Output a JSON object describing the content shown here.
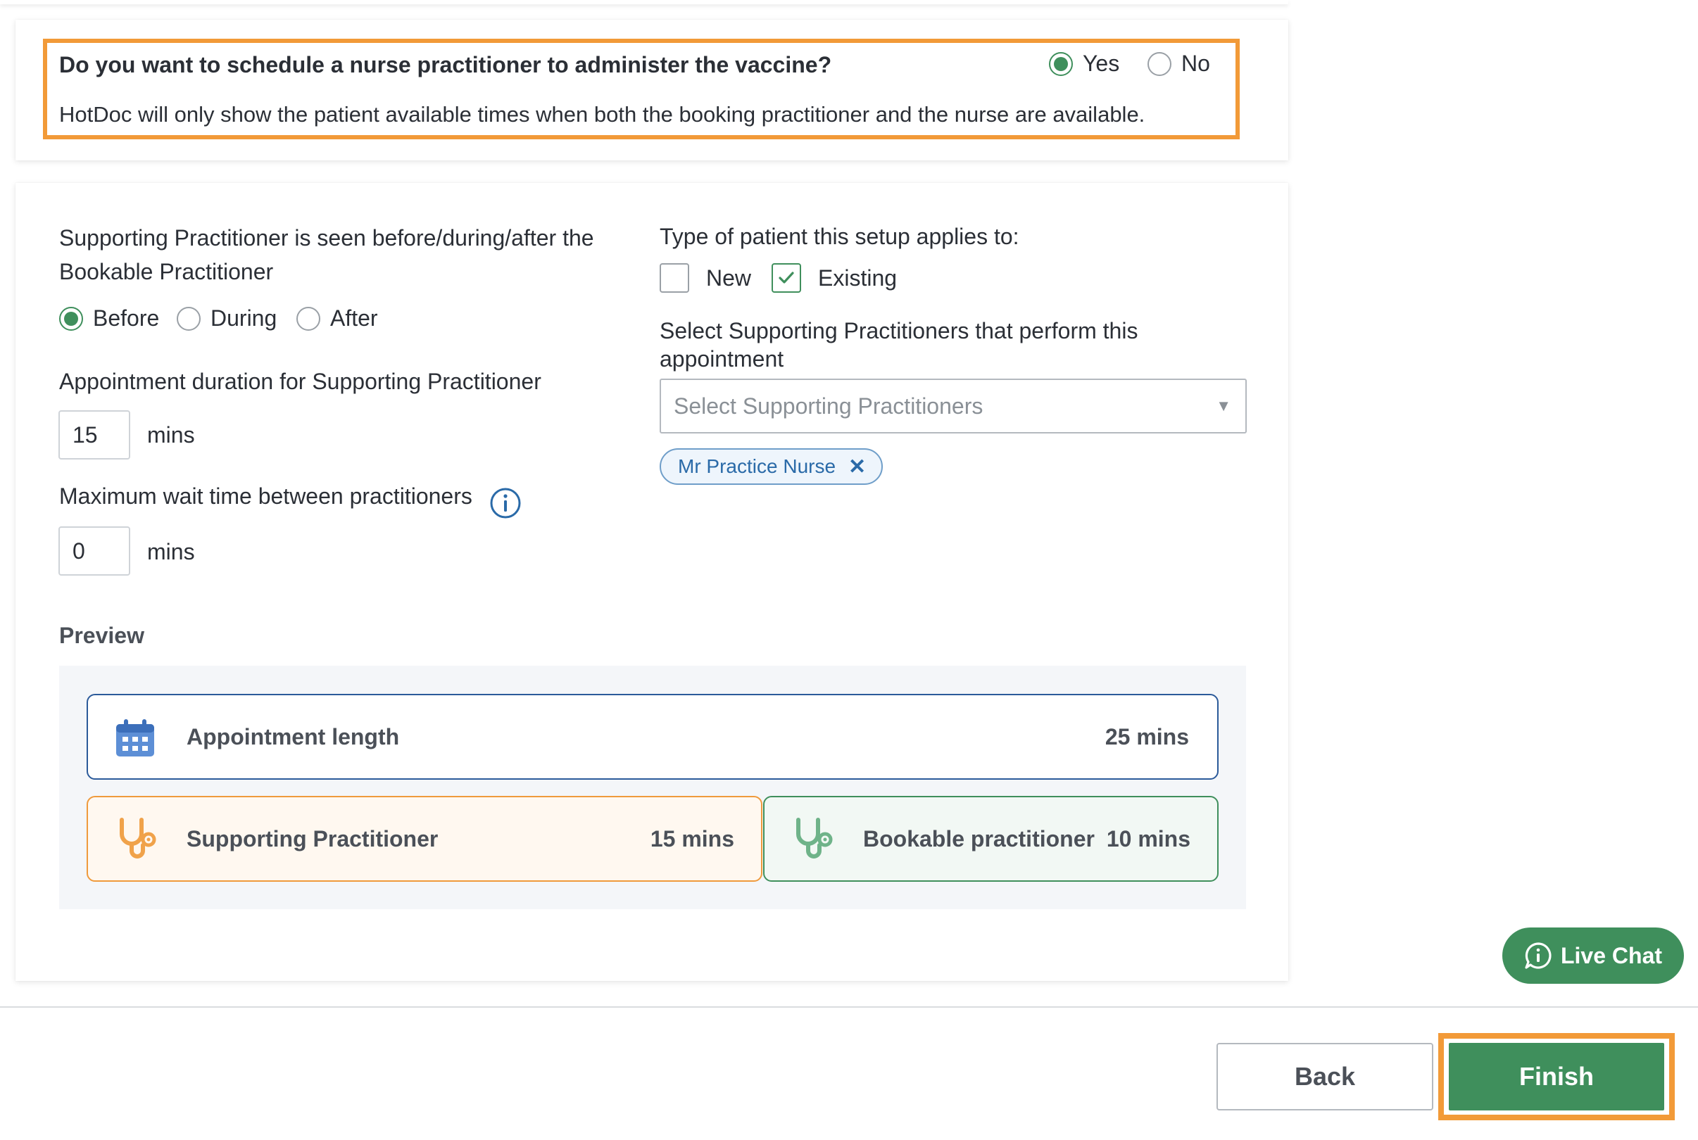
{
  "nurse_question": {
    "question": "Do you want to schedule a nurse practitioner to administer the vaccine?",
    "description": "HotDoc will only show the patient available times when both the booking practitioner and the nurse are available.",
    "options": [
      {
        "label": "Yes",
        "selected": true
      },
      {
        "label": "No",
        "selected": false
      }
    ]
  },
  "supporting": {
    "timing_label_line1": "Supporting Practitioner is seen before/during/after the",
    "timing_label_line2": "Bookable Practitioner",
    "timing_options": [
      {
        "label": "Before",
        "selected": true
      },
      {
        "label": "During",
        "selected": false
      },
      {
        "label": "After",
        "selected": false
      }
    ],
    "duration_label": "Appointment duration for Supporting Practitioner",
    "duration_value": "15",
    "duration_unit": "mins",
    "wait_label": "Maximum wait time between practitioners",
    "wait_value": "0",
    "wait_unit": "mins"
  },
  "patient_type": {
    "label": "Type of patient this setup applies to:",
    "options": [
      {
        "label": "New",
        "checked": false
      },
      {
        "label": "Existing",
        "checked": true
      }
    ]
  },
  "practitioners": {
    "label_line1": "Select Supporting Practitioners that perform this",
    "label_line2": "appointment",
    "placeholder": "Select Supporting Practitioners",
    "selected": [
      "Mr Practice Nurse"
    ]
  },
  "preview": {
    "title": "Preview",
    "total": {
      "label": "Appointment length",
      "value": "25 mins"
    },
    "supporting": {
      "label": "Supporting Practitioner",
      "value": "15 mins"
    },
    "bookable": {
      "label": "Bookable practitioner",
      "value": "10 mins"
    }
  },
  "footer": {
    "back_label": "Back",
    "finish_label": "Finish",
    "live_chat_label": "Live Chat"
  },
  "colors": {
    "primary_green": "#3f8f5c",
    "highlight_orange": "#f29a38",
    "accent_blue": "#2a6aa8"
  }
}
